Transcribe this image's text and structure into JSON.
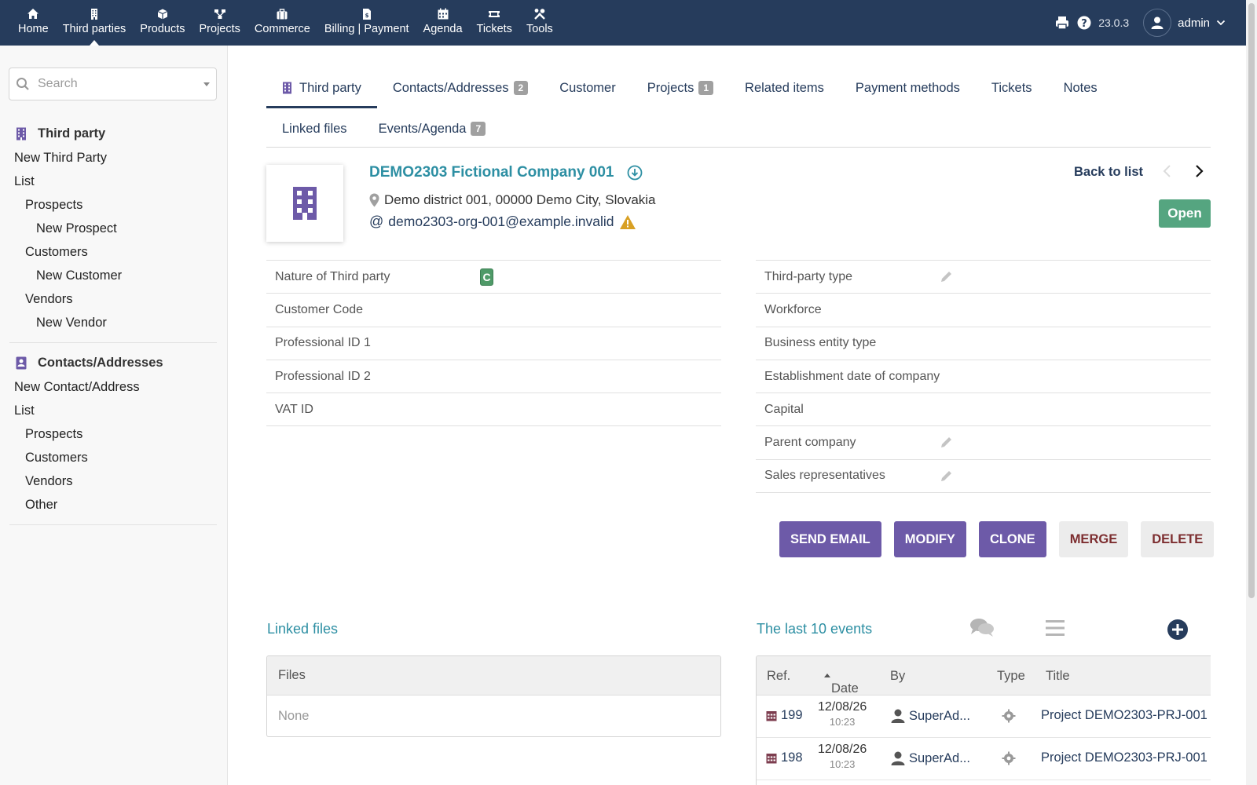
{
  "topnav": {
    "items": [
      {
        "label": "Home",
        "icon": "home-icon"
      },
      {
        "label": "Third parties",
        "icon": "building-icon",
        "active": true
      },
      {
        "label": "Products",
        "icon": "cube-icon"
      },
      {
        "label": "Projects",
        "icon": "project-icon"
      },
      {
        "label": "Commerce",
        "icon": "suitcase-icon"
      },
      {
        "label": "Billing | Payment",
        "icon": "invoice-icon"
      },
      {
        "label": "Agenda",
        "icon": "calendar-icon"
      },
      {
        "label": "Tickets",
        "icon": "ticket-icon"
      },
      {
        "label": "Tools",
        "icon": "tools-icon"
      }
    ],
    "version": "23.0.3",
    "user": "admin"
  },
  "sidebar": {
    "search_placeholder": "Search",
    "third_party": {
      "title": "Third party",
      "items": [
        {
          "label": "New Third Party",
          "level": 0
        },
        {
          "label": "List",
          "level": 0
        },
        {
          "label": "Prospects",
          "level": 1
        },
        {
          "label": "New Prospect",
          "level": 2
        },
        {
          "label": "Customers",
          "level": 1
        },
        {
          "label": "New Customer",
          "level": 2
        },
        {
          "label": "Vendors",
          "level": 1
        },
        {
          "label": "New Vendor",
          "level": 2
        }
      ]
    },
    "contacts": {
      "title": "Contacts/Addresses",
      "items": [
        {
          "label": "New Contact/Address",
          "level": 0
        },
        {
          "label": "List",
          "level": 0
        },
        {
          "label": "Prospects",
          "level": 1
        },
        {
          "label": "Customers",
          "level": 1
        },
        {
          "label": "Vendors",
          "level": 1
        },
        {
          "label": "Other",
          "level": 1
        }
      ]
    }
  },
  "tabs": {
    "row1": [
      {
        "label": "Third party",
        "icon": "building-icon",
        "active": true
      },
      {
        "label": "Contacts/Addresses",
        "badge": "2"
      },
      {
        "label": "Customer"
      },
      {
        "label": "Projects",
        "badge": "1"
      },
      {
        "label": "Related items"
      },
      {
        "label": "Payment methods"
      },
      {
        "label": "Tickets"
      },
      {
        "label": "Notes"
      }
    ],
    "row2": [
      {
        "label": "Linked files"
      },
      {
        "label": "Events/Agenda",
        "badge": "7"
      }
    ]
  },
  "company": {
    "name": "DEMO2303 Fictional Company 001",
    "address": "Demo district 001, 00000 Demo City, Slovakia",
    "email": "demo2303-org-001@example.invalid",
    "status": "Open",
    "back_to_list": "Back to list"
  },
  "fields_left": [
    {
      "label": "Nature of Third party",
      "value": "C"
    },
    {
      "label": "Customer Code"
    },
    {
      "label": "Professional ID 1"
    },
    {
      "label": "Professional ID 2"
    },
    {
      "label": "VAT ID"
    }
  ],
  "fields_right": [
    {
      "label": "Third-party type",
      "editable": true
    },
    {
      "label": "Workforce"
    },
    {
      "label": "Business entity type"
    },
    {
      "label": "Establishment date of company"
    },
    {
      "label": "Capital"
    },
    {
      "label": "Parent company",
      "editable": true
    },
    {
      "label": "Sales representatives",
      "editable": true
    }
  ],
  "actions": [
    {
      "label": "SEND EMAIL",
      "style": "primary"
    },
    {
      "label": "MODIFY",
      "style": "primary"
    },
    {
      "label": "CLONE",
      "style": "primary"
    },
    {
      "label": "MERGE",
      "style": "secondary"
    },
    {
      "label": "DELETE",
      "style": "secondary"
    }
  ],
  "linked_files": {
    "title": "Linked files",
    "header": "Files",
    "empty": "None"
  },
  "events": {
    "title": "The last 10 events",
    "columns": [
      "Ref.",
      "Date",
      "By",
      "Type",
      "Title"
    ],
    "rows": [
      {
        "ref": "199",
        "date": "12/08/26",
        "time": "10:23",
        "by": "SuperAd...",
        "title": "Project DEMO2303-PRJ-001"
      },
      {
        "ref": "198",
        "date": "12/08/26",
        "time": "10:23",
        "by": "SuperAd...",
        "title": "Project DEMO2303-PRJ-001"
      }
    ]
  },
  "colors": {
    "topbar": "#263c5c",
    "link": "#263c5c",
    "accent": "#2d8fa3",
    "primary_button": "#6d5aa8",
    "status_open": "#55a580"
  }
}
